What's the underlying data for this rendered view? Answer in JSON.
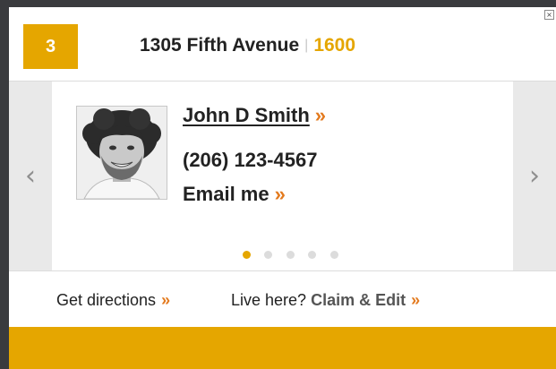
{
  "header": {
    "badge_number": "3",
    "address": "1305 Fifth Avenue",
    "separator": "|",
    "unit_number": "1600"
  },
  "profile": {
    "name": "John D Smith",
    "name_chevron": "»",
    "phone": "(206) 123-4567",
    "email_label": "Email me",
    "email_chevron": "»"
  },
  "carousel": {
    "total_pages": 5,
    "active_page": 1
  },
  "footer": {
    "directions_label": "Get directions",
    "directions_chevron": "»",
    "live_here_label": "Live here?",
    "claim_label": "Claim & Edit",
    "claim_chevron": "»"
  },
  "colors": {
    "accent": "#e5a600",
    "chevron": "#e37a1e",
    "background": "#3a3b3e"
  },
  "icons": {
    "close": "close-icon",
    "prev": "chevron-left-icon",
    "next": "chevron-right-icon"
  }
}
